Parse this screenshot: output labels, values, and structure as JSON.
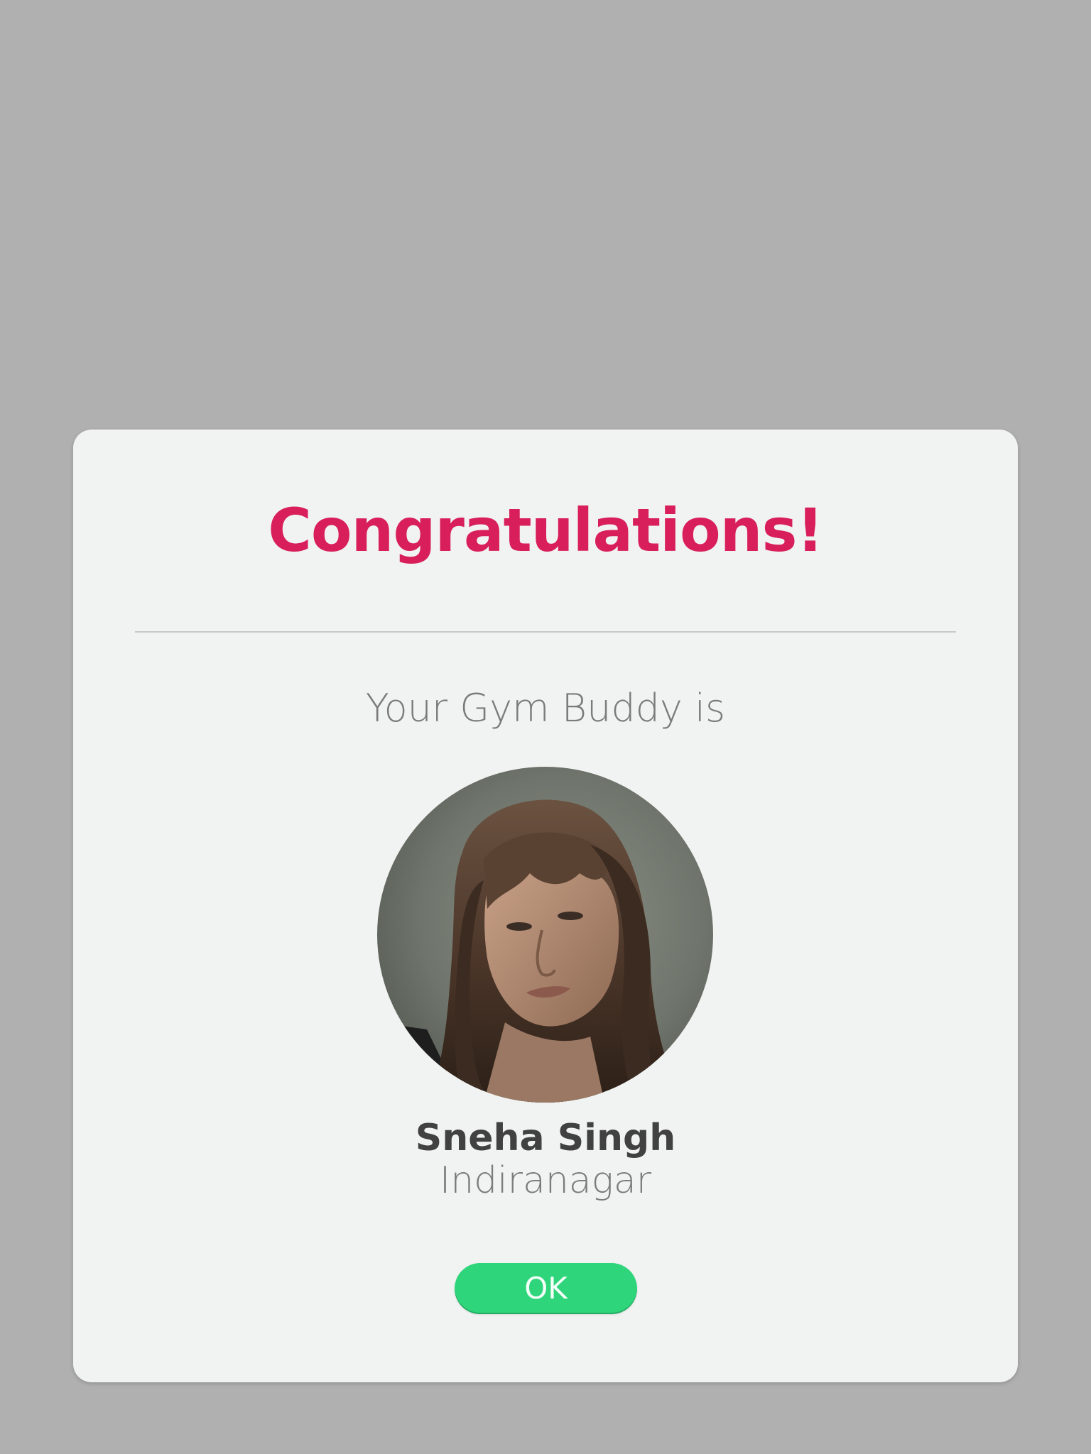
{
  "dialog": {
    "title": "Congratulations!",
    "subtitle": "Your Gym Buddy is",
    "buddy": {
      "name": "Sneha Singh",
      "location": "Indiranagar"
    },
    "ok_label": "OK"
  },
  "colors": {
    "overlay": "#b0b0b0",
    "dialog_bg": "#f1f3f2",
    "title": "#d81e5b",
    "ok_button": "#2fd57b"
  },
  "icons": {
    "avatar": "profile-photo"
  }
}
